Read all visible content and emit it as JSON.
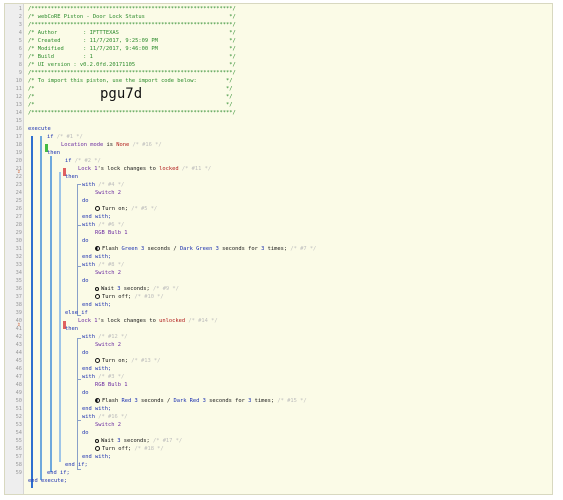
{
  "lines": {
    "1": "/**************************************************************/",
    "2": "/* webCoRE Piston - Door Lock Status                          */",
    "3": "/**************************************************************/",
    "4": "/* Author        : IFTTTEXAS                                  */",
    "5": "/* Created       : 11/7/2017, 9:25:09 PM                      */",
    "6": "/* Modified      : 11/7/2017, 9:46:00 PM                      */",
    "7": "/* Build         : 1                                          */",
    "8": "/* UI version : v0.2.0fd.20171105                             */",
    "9": "/**************************************************************/",
    "10": "/* To import this piston, use the import code below:         */",
    "11": "/*                                                           */",
    "12": "/*                                                           */",
    "13": "/*                                                           */",
    "14": "/**************************************************************/"
  },
  "import_code": "pgu7d",
  "code": {
    "execute": "execute",
    "if": "if",
    "c1": "/* #1 */",
    "location_mode": "Location mode",
    "is": "is",
    "none": "None",
    "c16": "/* #16 */",
    "then": "then",
    "c2": "/* #2 */",
    "lock1": "Lock 1",
    "s_lock": "'s lock",
    "changes_to": "changes to",
    "locked": "locked",
    "c11": "/* #11 */",
    "with": "with",
    "c4": "/* #4 */",
    "switch2": "Switch 2",
    "do": "do",
    "turn_on": "Turn on;",
    "c5": "/* #5 */",
    "end_with": "end with;",
    "c6": "/* #6 */",
    "rgb1": "RGB Bulb 1",
    "flash": "Flash",
    "green": "Green",
    "n3": "3",
    "seconds_slash": "seconds /",
    "dark_green": "Dark Green",
    "seconds_for": "seconds for",
    "times": "times;",
    "c7": "/* #7 */",
    "c8": "/* #8 */",
    "wait": "Wait",
    "seconds_semi": "seconds;",
    "c9": "/* #9 */",
    "turn_off": "Turn off;",
    "c10": "/* #10 */",
    "else_if": "else if",
    "unlocked": "unlocked",
    "c14": "/* #14 */",
    "c12": "/* #12 */",
    "c13": "/* #13 */",
    "c3": "/* #3 */",
    "red": "Red",
    "dark_red": "Dark Red",
    "c15": "/* #15 */",
    "c17": "/* #17 */",
    "c18": "/* #18 */",
    "end_if": "end if;",
    "end_execute": "end execute;"
  },
  "colors": {
    "editor_bg": "#fbfbe7",
    "comment": "#2a8a2a",
    "keyword": "#1a2fb0",
    "device": "#6a2aa0",
    "value": "#b01818",
    "block_bar": "#6fa8dc"
  }
}
